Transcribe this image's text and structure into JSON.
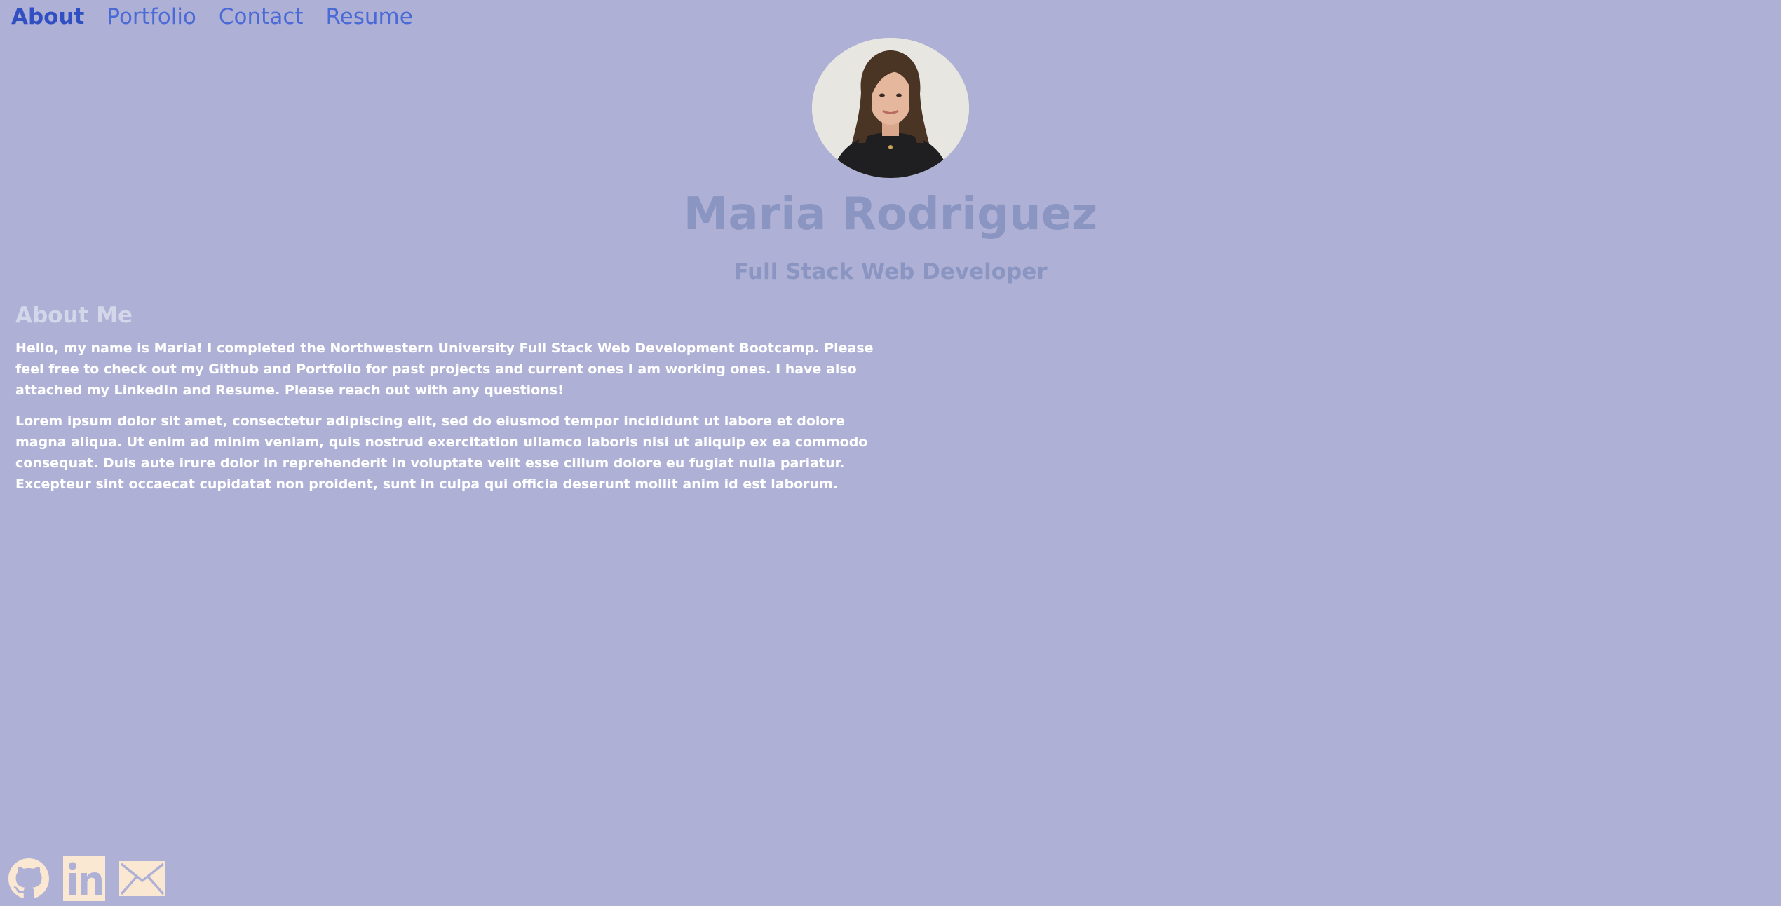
{
  "nav": {
    "items": [
      {
        "label": "About",
        "active": true
      },
      {
        "label": "Portfolio",
        "active": false
      },
      {
        "label": "Contact",
        "active": false
      },
      {
        "label": "Resume",
        "active": false
      }
    ]
  },
  "hero": {
    "name": "Maria Rodriguez",
    "title": "Full Stack Web Developer"
  },
  "about": {
    "heading": "About Me",
    "paragraphs": [
      "Hello, my name is Maria! I completed the Northwestern University Full Stack Web Development Bootcamp. Please feel free to check out my Github and Portfolio for past projects and current ones I am working ones. I have also attached my LinkedIn and Resume. Please reach out with any questions!",
      "Lorem ipsum dolor sit amet, consectetur adipiscing elit, sed do eiusmod tempor incididunt ut labore et dolore magna aliqua. Ut enim ad minim veniam, quis nostrud exercitation ullamco laboris nisi ut aliquip ex ea commodo consequat. Duis aute irure dolor in reprehenderit in voluptate velit esse cillum dolore eu fugiat nulla pariatur. Excepteur sint occaecat cupidatat non proident, sunt in culpa qui officia deserunt mollit anim id est laborum."
    ]
  },
  "social": {
    "icons": [
      "github-icon",
      "linkedin-icon",
      "mail-icon"
    ]
  },
  "colors": {
    "background": "#aeb1d5",
    "nav_link": "#4a6ad6",
    "nav_active": "#2f4fc2",
    "hero_text": "#8a95c2",
    "about_heading": "#d4d6ea",
    "icon_fill": "#fbe8d3"
  }
}
